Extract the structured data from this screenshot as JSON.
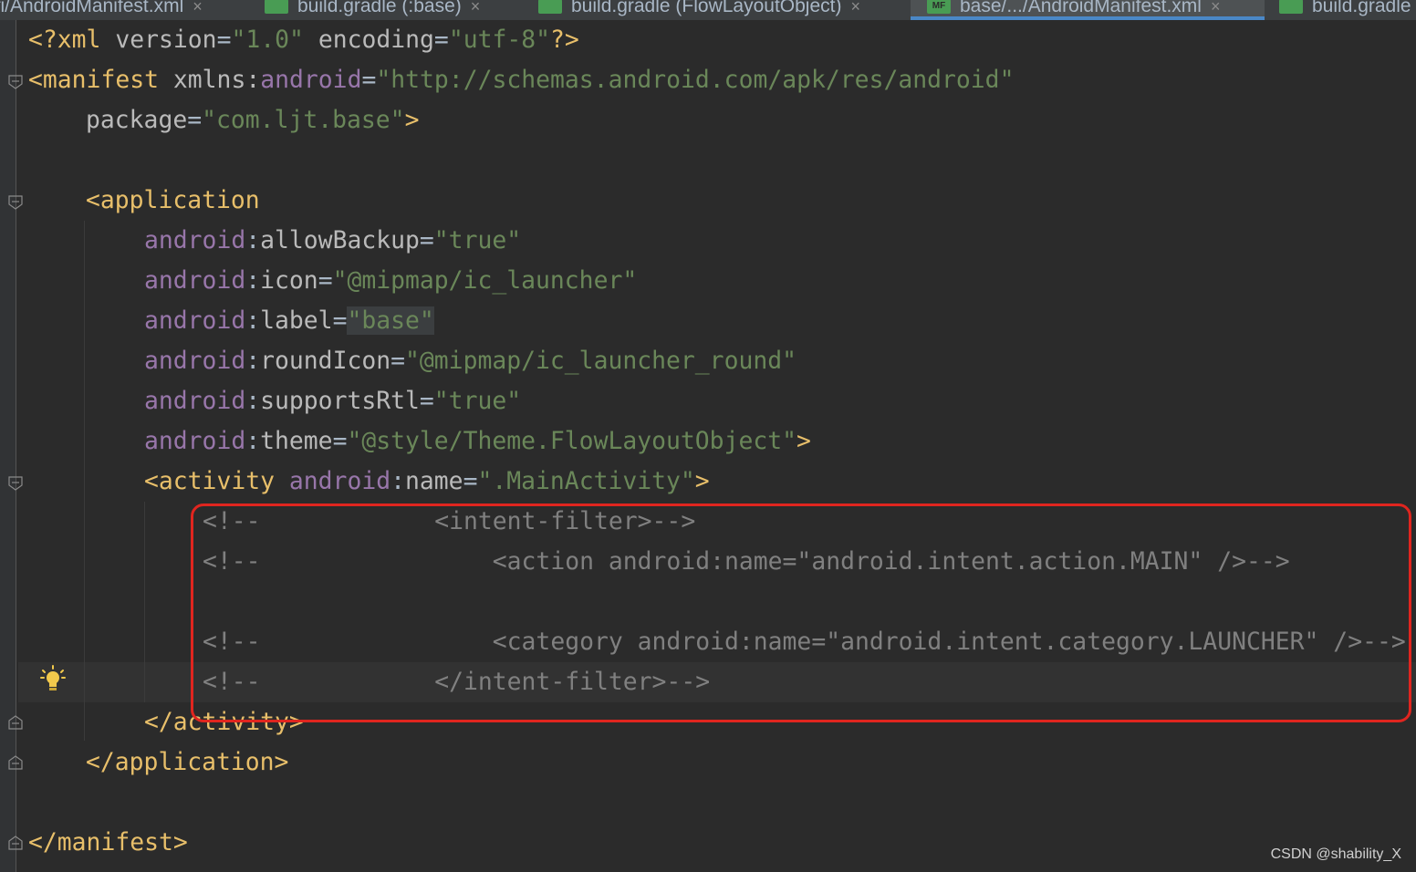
{
  "tabs": [
    {
      "label": "ifi/AndroidManifest.xml",
      "active": false,
      "icon": "android-manifest-icon"
    },
    {
      "label": "build.gradle (:base)",
      "active": false,
      "icon": "gradle-icon"
    },
    {
      "label": "build.gradle (FlowLayoutObject)",
      "active": false,
      "icon": "gradle-icon"
    },
    {
      "label": "base/.../AndroidManifest.xml",
      "active": true,
      "icon": "manifest-file-icon",
      "icon_text": "MF"
    },
    {
      "label": "build.gradle",
      "active": false,
      "icon": "gradle-icon"
    }
  ],
  "code": {
    "l1": {
      "a": "<?xml ",
      "b": "version",
      "c": "=",
      "d": "\"1.0\"",
      "e": " ",
      "f": "encoding",
      "g": "=",
      "h": "\"utf-8\"",
      "i": "?>"
    },
    "l2": {
      "a": "<manifest ",
      "b": "xmlns:",
      "c": "android",
      "d": "=",
      "e": "\"http://schemas.android.com/apk/res/android\""
    },
    "l3": {
      "a": "package",
      "b": "=",
      "c": "\"com.ljt.base\"",
      "d": ">"
    },
    "l5": {
      "a": "<application"
    },
    "l6": {
      "ns": "android",
      "colon": ":",
      "attr": "allowBackup",
      "eq": "=",
      "val": "\"true\""
    },
    "l7": {
      "ns": "android",
      "colon": ":",
      "attr": "icon",
      "eq": "=",
      "val": "\"@mipmap/ic_launcher\""
    },
    "l8": {
      "ns": "android",
      "colon": ":",
      "attr": "label",
      "eq": "=",
      "val": "\"base\""
    },
    "l9": {
      "ns": "android",
      "colon": ":",
      "attr": "roundIcon",
      "eq": "=",
      "val": "\"@mipmap/ic_launcher_round\""
    },
    "l10": {
      "ns": "android",
      "colon": ":",
      "attr": "supportsRtl",
      "eq": "=",
      "val": "\"true\""
    },
    "l11": {
      "ns": "android",
      "colon": ":",
      "attr": "theme",
      "eq": "=",
      "val": "\"@style/Theme.FlowLayoutObject\"",
      "end": ">"
    },
    "l12": {
      "a": "<activity ",
      "ns": "android",
      "colon": ":",
      "attr": "name",
      "eq": "=",
      "val": "\".MainActivity\"",
      "end": ">"
    },
    "l13": "<!--            <intent-filter>-->",
    "l14": "<!--                <action android:name=\"android.intent.action.MAIN\" />-->",
    "l16": "<!--                <category android:name=\"android.intent.category.LAUNCHER\" />-->",
    "l17": "<!--            </intent-filter>-->",
    "l18": "</activity>",
    "l19": "</application>",
    "l21": "</manifest>"
  },
  "watermark": "CSDN @shability_X",
  "colors": {
    "annotation": "#e0251f",
    "tag": "#e8bf6a",
    "namespace": "#9876aa",
    "string": "#6a8759",
    "comment": "#808080"
  }
}
